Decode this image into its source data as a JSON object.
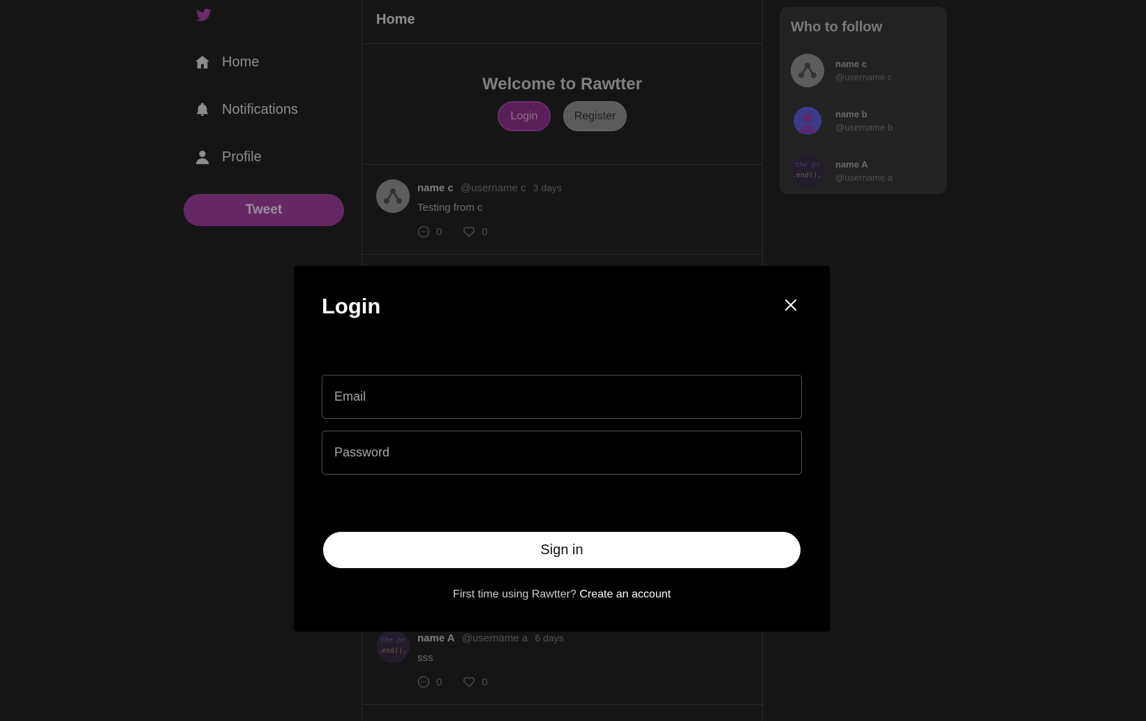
{
  "sidebar": {
    "logo_icon": "bird-logo-icon",
    "items": [
      {
        "label": "Home",
        "icon": "home-icon"
      },
      {
        "label": "Notifications",
        "icon": "bell-icon"
      },
      {
        "label": "Profile",
        "icon": "user-icon"
      }
    ],
    "tweet_button": "Tweet"
  },
  "main": {
    "header": "Home",
    "welcome": {
      "title": "Welcome to Rawtter",
      "login_label": "Login",
      "register_label": "Register"
    },
    "tweets": [
      {
        "name": "name c",
        "username": "@username c",
        "time": "3 days",
        "text": "Testing from c",
        "replies": "0",
        "likes": "0"
      },
      {
        "name": "name A",
        "username": "@username a",
        "time": "6 days",
        "text": "sss",
        "replies": "0",
        "likes": "0"
      }
    ]
  },
  "who_to_follow": {
    "title": "Who to follow",
    "users": [
      {
        "name": "name c",
        "username": "@username c"
      },
      {
        "name": "name b",
        "username": "@username b"
      },
      {
        "name": "name A",
        "username": "@username a"
      }
    ]
  },
  "avatar_text": {
    "line1": "the pr",
    "line2": ".end(),"
  },
  "modal": {
    "title": "Login",
    "email_placeholder": "Email",
    "password_placeholder": "Password",
    "signin_label": "Sign in",
    "footer_text": "First time using Rawtter?",
    "create_account_label": "Create an account"
  },
  "colors": {
    "accent": "#642964",
    "background": "#151515",
    "modal_bg": "#000000"
  }
}
